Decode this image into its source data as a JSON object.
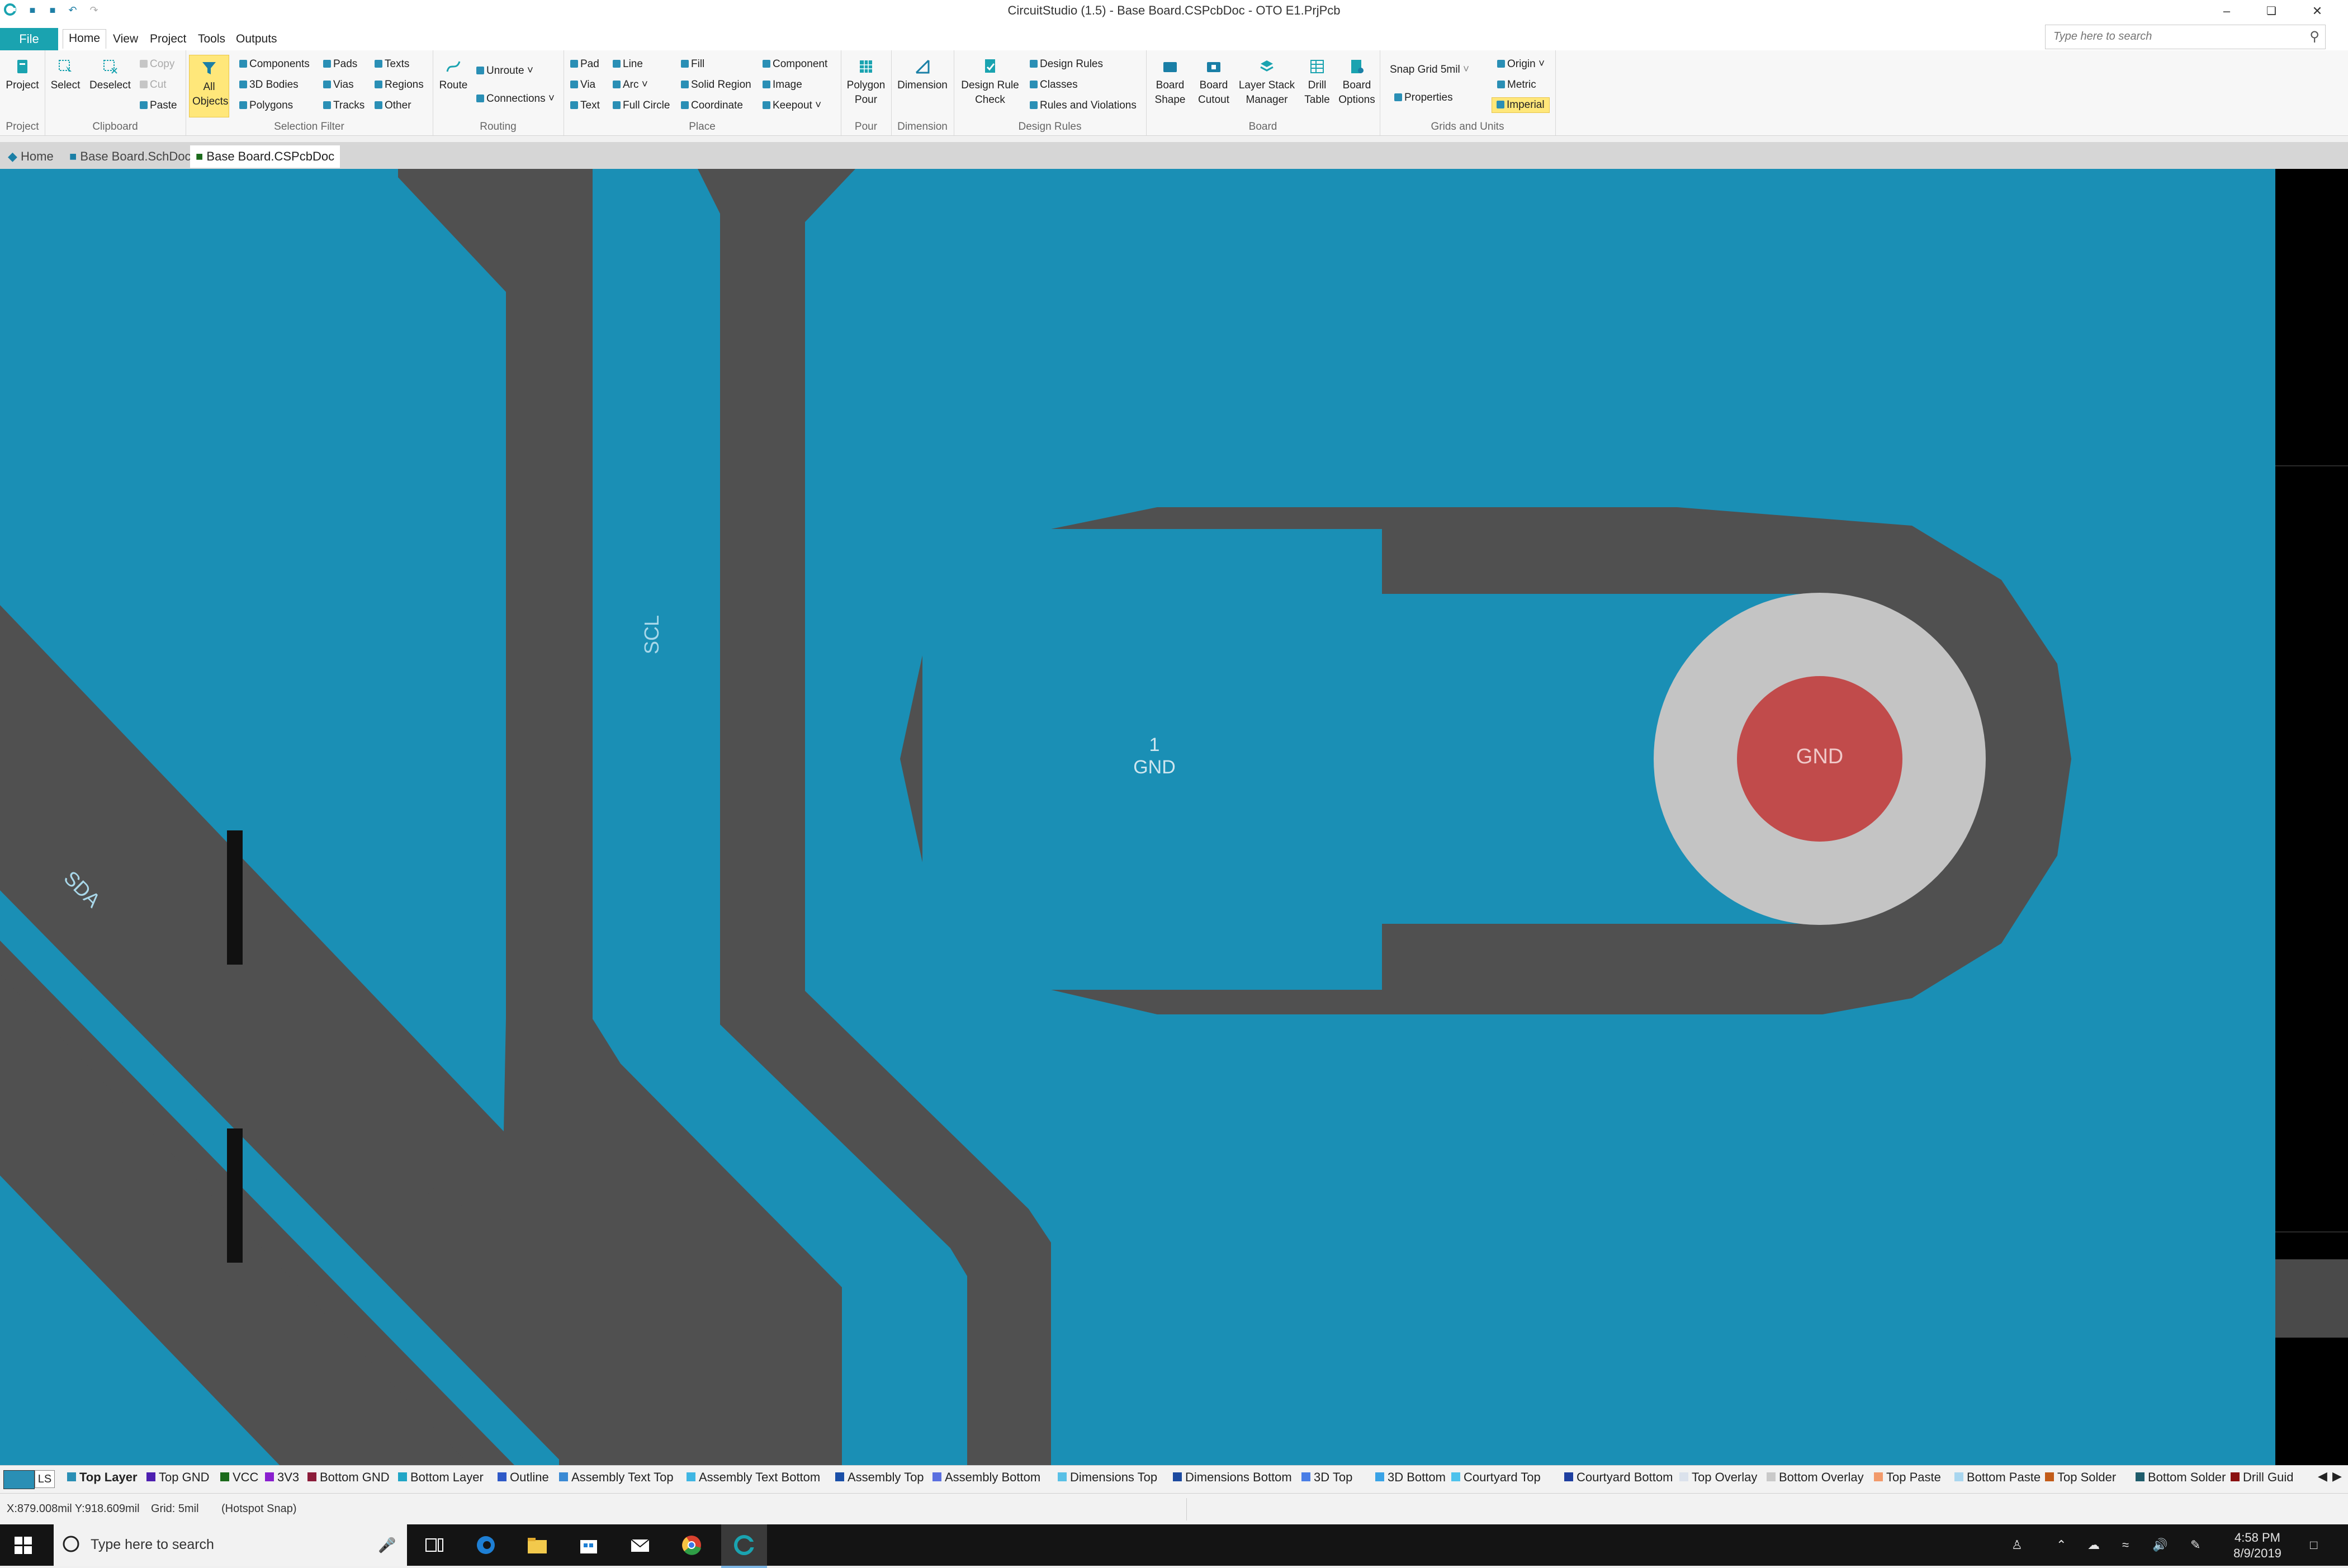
{
  "window": {
    "title": "CircuitStudio (1.5) - Base Board.CSPcbDoc - OTO E1.PrjPcb"
  },
  "menu": {
    "file": "File",
    "tabs": [
      "Home",
      "View",
      "Project",
      "Tools",
      "Outputs"
    ],
    "active_tab": "Home",
    "search_placeholder": "Type here to search"
  },
  "ribbon": {
    "project": {
      "project_btn": "Project",
      "label": "Project"
    },
    "clipboard": {
      "select": "Select",
      "deselect": "Deselect",
      "copy": "Copy",
      "cut": "Cut",
      "paste": "Paste",
      "label": "Clipboard"
    },
    "selection_filter": {
      "all_objects": "All Objects",
      "components": "Components",
      "bodies": "3D Bodies",
      "polygons": "Polygons",
      "pads": "Pads",
      "vias": "Vias",
      "tracks": "Tracks",
      "texts": "Texts",
      "regions": "Regions",
      "other": "Other",
      "label": "Selection Filter"
    },
    "routing": {
      "route": "Route",
      "unroute": "Unroute",
      "connections": "Connections",
      "label": "Routing"
    },
    "place": {
      "pad": "Pad",
      "via": "Via",
      "text": "Text",
      "line": "Line",
      "arc": "Arc",
      "full_circle": "Full Circle",
      "fill": "Fill",
      "solid_region": "Solid Region",
      "coordinate": "Coordinate",
      "component": "Component",
      "image": "Image",
      "keepout": "Keepout",
      "label": "Place"
    },
    "pour": {
      "polygon_pour": "Polygon Pour",
      "label": "Pour"
    },
    "dimension": {
      "dimension": "Dimension",
      "label": "Dimension"
    },
    "design_rules": {
      "drc": "Design Rule Check",
      "design_rules": "Design Rules",
      "classes": "Classes",
      "rules_violations": "Rules and Violations",
      "label": "Design Rules"
    },
    "board": {
      "board_shape": "Board Shape",
      "board_cutout": "Board Cutout",
      "layer_stack": "Layer Stack Manager",
      "drill_table": "Drill Table",
      "board_options": "Board Options",
      "label": "Board"
    },
    "grids": {
      "snap_grid_label": "Snap Grid",
      "snap_grid_value": "5mil",
      "properties": "Properties",
      "origin": "Origin",
      "metric": "Metric",
      "imperial": "Imperial",
      "label": "Grids and Units"
    }
  },
  "doc_tabs": [
    "Home",
    "Base Board.SchDoc",
    "Base Board.CSPcbDoc"
  ],
  "active_doc": "Base Board.CSPcbDoc",
  "pcb": {
    "scl_label": "SCL",
    "sda_label": "SDA",
    "pad_designator": "1",
    "pad_net": "GND",
    "via_net": "GND",
    "colors": {
      "board": "#1a8fb5",
      "keepout": "#505050",
      "pad_ring": "#c4c4c4",
      "hole": "#c14b4b"
    }
  },
  "layers": {
    "ls": "LS",
    "items": [
      {
        "name": "Top Layer",
        "color": "#2a8fb5"
      },
      {
        "name": "Top GND",
        "color": "#4d1fb0"
      },
      {
        "name": "VCC",
        "color": "#1c6b1c"
      },
      {
        "name": "3V3",
        "color": "#8a1fcf"
      },
      {
        "name": "Bottom GND",
        "color": "#8b1c3a"
      },
      {
        "name": "Bottom Layer",
        "color": "#21a5c6"
      },
      {
        "name": "Outline",
        "color": "#2f59c7"
      },
      {
        "name": "Assembly Text Top",
        "color": "#3a8ad4"
      },
      {
        "name": "Assembly Text Bottom",
        "color": "#3fb6e3"
      },
      {
        "name": "Assembly Top",
        "color": "#1a4fa8"
      },
      {
        "name": "Assembly Bottom",
        "color": "#5a6fe0"
      },
      {
        "name": "Dimensions Top",
        "color": "#59c0e6"
      },
      {
        "name": "Dimensions Bottom",
        "color": "#1c4aa0"
      },
      {
        "name": "3D Top",
        "color": "#4a7ee6"
      },
      {
        "name": "3D Bottom",
        "color": "#3aa3e6"
      },
      {
        "name": "Courtyard Top",
        "color": "#4ec2ec"
      },
      {
        "name": "Courtyard Bottom",
        "color": "#1f3fa0"
      },
      {
        "name": "Top Overlay",
        "color": "#dbe2ec"
      },
      {
        "name": "Bottom Overlay",
        "color": "#c9c9c9"
      },
      {
        "name": "Top Paste",
        "color": "#f29a6b"
      },
      {
        "name": "Bottom Paste",
        "color": "#a9d6ef"
      },
      {
        "name": "Top Solder",
        "color": "#c25c1a"
      },
      {
        "name": "Bottom Solder",
        "color": "#1f5c6b"
      },
      {
        "name": "Drill Guid",
        "color": "#8a1010"
      }
    ]
  },
  "status": {
    "coords": "X:879.008mil Y:918.609mil",
    "grid": "Grid: 5mil",
    "snap": "(Hotspot Snap)"
  },
  "taskbar": {
    "search_placeholder": "Type here to search",
    "time": "4:58 PM",
    "date": "8/9/2019"
  }
}
